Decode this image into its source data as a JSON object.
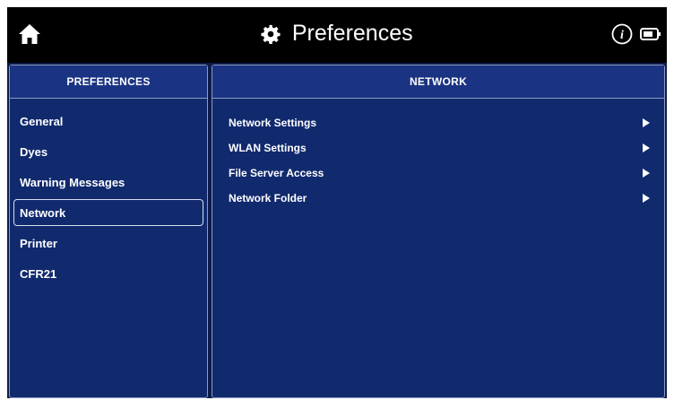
{
  "header": {
    "title": "Preferences",
    "icons": [
      "home-icon",
      "gear-icon",
      "info-icon",
      "battery-icon"
    ]
  },
  "sidebar": {
    "header": "PREFERENCES",
    "items": [
      {
        "label": "General"
      },
      {
        "label": "Dyes"
      },
      {
        "label": "Warning Messages"
      },
      {
        "label": "Network"
      },
      {
        "label": "Printer"
      },
      {
        "label": "CFR21"
      }
    ],
    "selected": "Network"
  },
  "main": {
    "header": "NETWORK",
    "items": [
      {
        "label": "Network Settings"
      },
      {
        "label": "WLAN Settings"
      },
      {
        "label": "File Server Access"
      },
      {
        "label": "Network Folder"
      }
    ]
  },
  "colors": {
    "topbar": "#000000",
    "panel": "#112a6e",
    "panel_header": "#1b3383",
    "border": "#8c9bc4",
    "text": "#ffffff"
  }
}
